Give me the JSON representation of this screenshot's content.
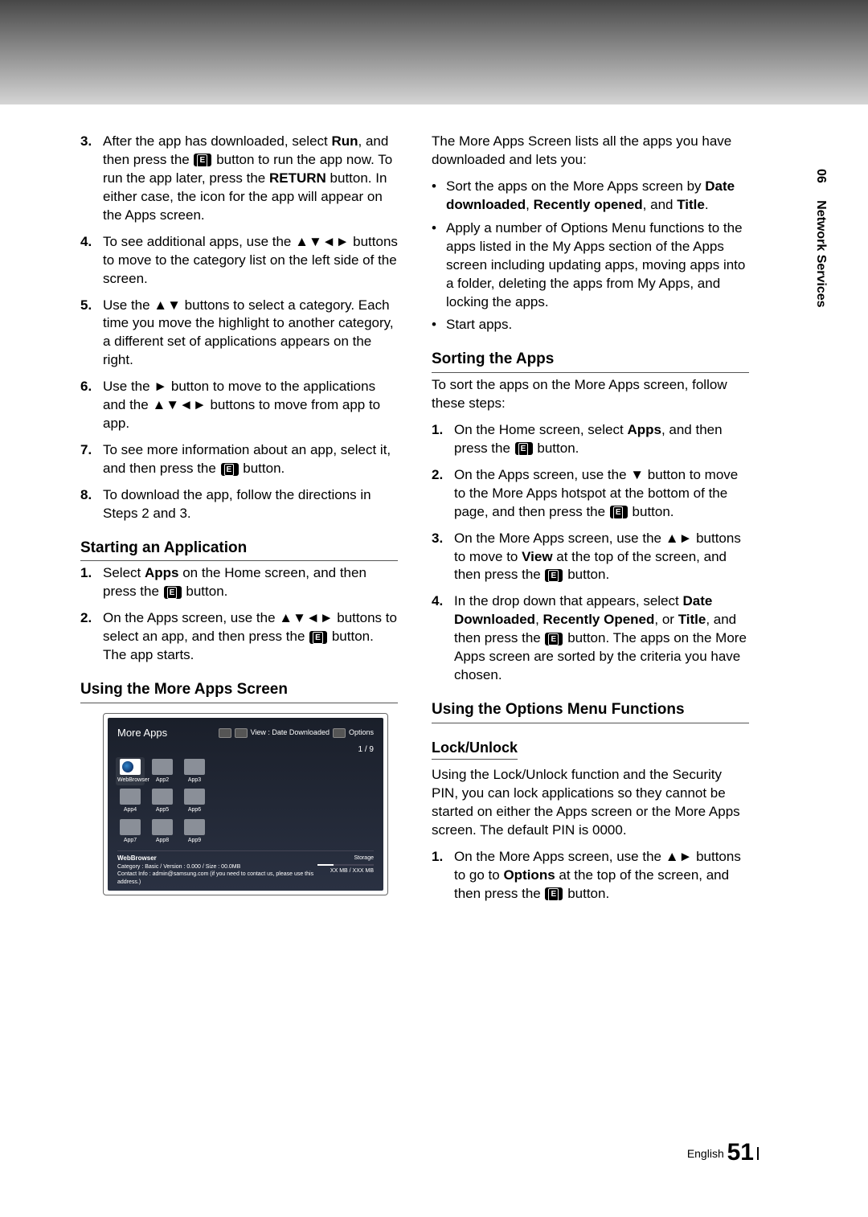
{
  "sideTab": {
    "chapter": "06",
    "title": "Network Services"
  },
  "leftList": [
    {
      "n": "3.",
      "html": "After the app has downloaded, select <b>Run</b>, and then press the [E] button to run the app now. To run the app later, press the <b>RETURN</b> button. In either case, the icon for the app will appear on the Apps screen."
    },
    {
      "n": "4.",
      "html": "To see additional apps, use the ▲▼◄► buttons to move to the category list on the left side of the screen."
    },
    {
      "n": "5.",
      "html": "Use the ▲▼ buttons to select a category. Each time you move the highlight to another category, a different set of applications appears on the right."
    },
    {
      "n": "6.",
      "html": "Use the ► button to move to the applications and the ▲▼◄► buttons to move from app to app."
    },
    {
      "n": "7.",
      "html": "To see more information about an app, select it, and then press the [E] button."
    },
    {
      "n": "8.",
      "html": "To download the app, follow the directions in Steps 2 and 3."
    }
  ],
  "h_start": "Starting an Application",
  "startList": [
    {
      "n": "1.",
      "html": "Select <b>Apps</b> on the Home screen, and then press the [E] button."
    },
    {
      "n": "2.",
      "html": "On the Apps screen, use the ▲▼◄► buttons to select an app, and then press the [E] button. The app starts."
    }
  ],
  "h_more": "Using the More Apps Screen",
  "screenshot": {
    "title": "More Apps",
    "viewLabel": "View : Date Downloaded",
    "optionsLabel": "Options",
    "page": "1 / 9",
    "apps": [
      {
        "label": "WebBrowser",
        "special": true
      },
      {
        "label": "App2"
      },
      {
        "label": "App3"
      },
      {
        "label": "App4"
      },
      {
        "label": "App5"
      },
      {
        "label": "App6"
      },
      {
        "label": "App7"
      },
      {
        "label": "App8"
      },
      {
        "label": "App9"
      }
    ],
    "footer": {
      "name": "WebBrowser",
      "meta": "Category : Basic / Version : 0.000 / Size : 00.0MB",
      "contact": "Contact Info : admin@samsung.com (if you need to contact us, please use this address.)",
      "storageLabel": "Storage",
      "storageVal": "XX MB / XXX  MB"
    }
  },
  "rightIntro": "The More Apps Screen lists all the apps you have downloaded and lets you:",
  "rightBullets": [
    "Sort the apps on the More Apps screen by <b>Date downloaded</b>, <b>Recently opened</b>, and <b>Title</b>.",
    "Apply a number of Options Menu functions to the apps listed in the My Apps section of the Apps screen including updating apps, moving apps into a folder, deleting the apps from My Apps, and locking the apps.",
    "Start apps."
  ],
  "h_sort": "Sorting the Apps",
  "sortIntro": "To sort the apps on the More Apps screen, follow these steps:",
  "sortList": [
    {
      "n": "1.",
      "html": "On the Home screen, select <b>Apps</b>, and then press the [E] button."
    },
    {
      "n": "2.",
      "html": "On the Apps screen, use the ▼ button to move to the More Apps hotspot at the bottom of the page, and then press the [E] button."
    },
    {
      "n": "3.",
      "html": "On the More Apps screen, use the ▲► buttons to move to <b>View</b> at the top of the screen, and then press the [E] button."
    },
    {
      "n": "4.",
      "html": "In the drop down that appears, select <b>Date Downloaded</b>, <b>Recently Opened</b>, or <b>Title</b>, and then press the [E] button. The apps on the More Apps screen are sorted by the criteria you have chosen."
    }
  ],
  "h_opt": "Using the Options Menu Functions",
  "h_lock": "Lock/Unlock",
  "lockIntro": "Using the Lock/Unlock function and the Security PIN, you can lock applications so they cannot be started on either the Apps screen or the More Apps screen. The default PIN is 0000.",
  "lockList": [
    {
      "n": "1.",
      "html": "On the More Apps screen, use the ▲► buttons to go to <b>Options</b> at the top of the screen, and then press the [E] button."
    }
  ],
  "footer": {
    "lang": "English",
    "page": "51"
  }
}
